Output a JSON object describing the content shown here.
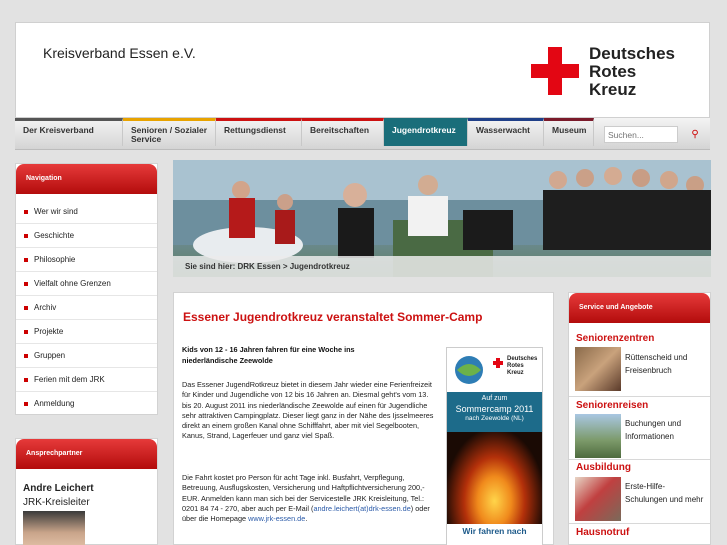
{
  "header": {
    "org_name": "Kreisverband Essen e.V.",
    "drk_line1": "Deutsches",
    "drk_line2": "Rotes",
    "drk_line3": "Kreuz"
  },
  "nav": {
    "tabs": [
      {
        "label": "Der Kreisverband",
        "color": "#555555"
      },
      {
        "label": "Senioren / Sozialer Service",
        "color": "#e8a300"
      },
      {
        "label": "Rettungsdienst",
        "color": "#cc1111"
      },
      {
        "label": "Bereitschaften",
        "color": "#cc1111"
      },
      {
        "label": "Jugendrotkreuz",
        "color": "#1a6e7a"
      },
      {
        "label": "Wasserwacht",
        "color": "#1f3f88"
      },
      {
        "label": "Museum",
        "color": "#7a1a2a"
      }
    ],
    "search_placeholder": "Suchen..."
  },
  "leftnav": {
    "heading": "Navigation",
    "items": [
      "Wer wir sind",
      "Geschichte",
      "Philosophie",
      "Vielfalt ohne Grenzen",
      "Archiv",
      "Projekte",
      "Gruppen",
      "Ferien mit dem JRK",
      "Anmeldung"
    ]
  },
  "contact": {
    "heading": "Ansprechpartner",
    "name": "Andre Leichert",
    "role": "JRK-Kreisleiter"
  },
  "breadcrumb": {
    "prefix": "Sie sind hier:",
    "path": "DRK Essen > Jugendrotkreuz"
  },
  "article": {
    "title": "Essener Jugendrotkreuz veranstaltet Sommer-Camp",
    "lead": "Kids von 12 - 16 Jahren fahren für eine Woche ins niederländische Zeewolde",
    "para1": "Das Essener JugendRotkreuz bietet in diesem Jahr wieder eine Ferienfreizeit für Kinder und Jugendliche von 12 bis 16 Jahren an. Diesmal geht's vom 13. bis 20. August 2011 ins niederländische Zeewolde auf einen für Jugendliche sehr attraktiven Campingplatz. Dieser liegt ganz in der Nähe des Ijsselmeeres direkt an einem großen Kanal ohne Schifffahrt, aber mit viel Segelbooten, Kanus, Strand, Lagerfeuer und ganz viel Spaß.",
    "para2_start": "Die Fahrt kostet pro Person für acht Tage inkl. Busfahrt, Verpflegung, Betreuung, Ausflugskosten, Versicherung und Haftpflichtversicherung 200,- EUR. Anmelden kann man sich bei der Servicestelle JRK Kreisleitung, Tel.: 0201 84 74 - 270, aber auch per E-Mail (",
    "email": "andre.leichert(at)drk-essen.de",
    "para2_mid": ") oder über die Homepage ",
    "website": "www.jrk-essen.de",
    "para2_end": "."
  },
  "poster": {
    "title_line1": "Auf zum",
    "title_line2": "Sommercamp 2011",
    "title_line3": "nach Zeewolde (NL)",
    "footer": "Wir fahren nach",
    "drk_line1": "Deutsches",
    "drk_line2": "Rotes",
    "drk_line3": "Kreuz"
  },
  "rightbar": {
    "heading": "Service und Angebote",
    "sections": [
      {
        "title": "Seniorenzentren",
        "text": "Rüttenscheid und Freisenbruch"
      },
      {
        "title": "Seniorenreisen",
        "text": "Buchungen und Informationen"
      },
      {
        "title": "Ausbildung",
        "text": "Erste-Hilfe-Schulungen und mehr"
      },
      {
        "title": "Hausnotruf",
        "text": ""
      }
    ]
  },
  "colors": {
    "brand_red": "#cc1111",
    "jrk_teal": "#1a6e7a"
  }
}
